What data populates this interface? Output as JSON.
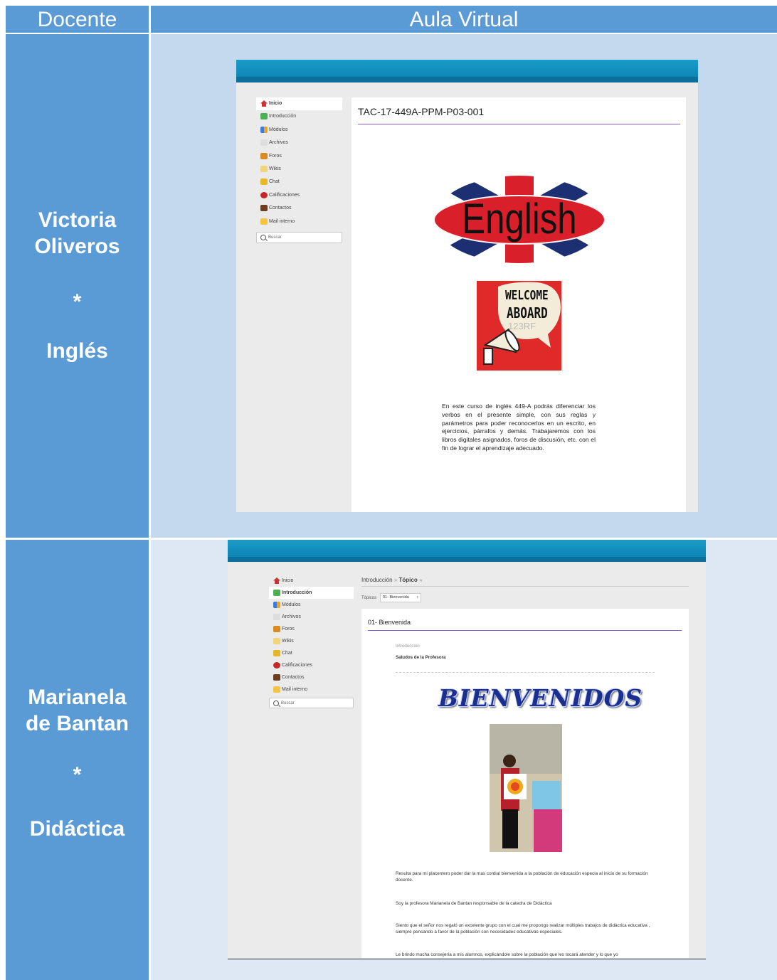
{
  "header": {
    "left": "Docente",
    "right": "Aula Virtual"
  },
  "rows": [
    {
      "teacher": {
        "name_line1": "Victoria",
        "name_line2": "Oliveros",
        "separator": "*",
        "subject": "Inglés"
      },
      "screen": {
        "menu": [
          "Inicio",
          "Introducción",
          "Módulos",
          "Archivos",
          "Foros",
          "Wikis",
          "Chat",
          "Calificaciones",
          "Contactos",
          "Mail interno"
        ],
        "search_placeholder": "Buscar",
        "course_title": "TAC-17-449A-PPM-P03-001",
        "logo_text": "English",
        "welcome_line1": "WELCOME",
        "welcome_line2": "ABOARD",
        "welcome_watermark": "123RF",
        "description": "En este curso de inglés 449-A podrás diferenciar los verbos en el presente simple, con sus reglas y parámetros para poder reconocerlos en un escrito, en ejercicios, párrafos y demás. Trabajaremos con los libros digitales asignados, foros de discusión, etc. con el fin de lograr el aprendizaje adecuado."
      }
    },
    {
      "teacher": {
        "name_line1": "Marianela",
        "name_line2": "de Bantan",
        "separator": "*",
        "subject": "Didáctica"
      },
      "screen": {
        "menu": [
          "Inicio",
          "Introducción",
          "Módulos",
          "Archivos",
          "Foros",
          "Wikis",
          "Chat",
          "Calificaciones",
          "Contactos",
          "Mail interno"
        ],
        "search_placeholder": "Buscar",
        "breadcrumb_part1": "Introducción",
        "breadcrumb_sep": "»",
        "breadcrumb_part2": "Tópico",
        "breadcrumb_star": "★",
        "topic_label": "Tópicos",
        "topic_value": "01- Bienvenida",
        "section_title": "01- Bienvenida",
        "intro_label": "Introducción",
        "intro_heading": "Saludos de la Profesora",
        "banner": "BIENVENIDOS",
        "p1": "Resulta para mi placentero poder dar la mas cordial bienvenida a la población de educación especia al inicio de su formación docente.",
        "p2": "Soy la profesora Marianela de Bantan responsable de la catedra de Didáctica",
        "p3": "Siento que el señor nos regaló un excelente grupo con el cual me propongo realizar múltiples trabajos de didáctica educativa , siempre pensando a favor de la población con necesidades educativas especiales.",
        "p4": "Le brindo mucha consejería a mis alumnos, explicándole sobre la población que les tocará atender y lo que yo"
      }
    }
  ],
  "colors": {
    "header_blue": "#5b9bd5",
    "row1_bg": "#c5d9ee",
    "row2_bg": "#dde8f4",
    "accent_purple": "#8b5bbf",
    "topbar_blue": "#1a9cc9"
  },
  "icons": [
    "home-icon",
    "intro-icon",
    "modules-icon",
    "files-icon",
    "forums-icon",
    "wikis-icon",
    "chat-icon",
    "grades-icon",
    "contacts-icon",
    "mail-icon",
    "search-icon"
  ]
}
